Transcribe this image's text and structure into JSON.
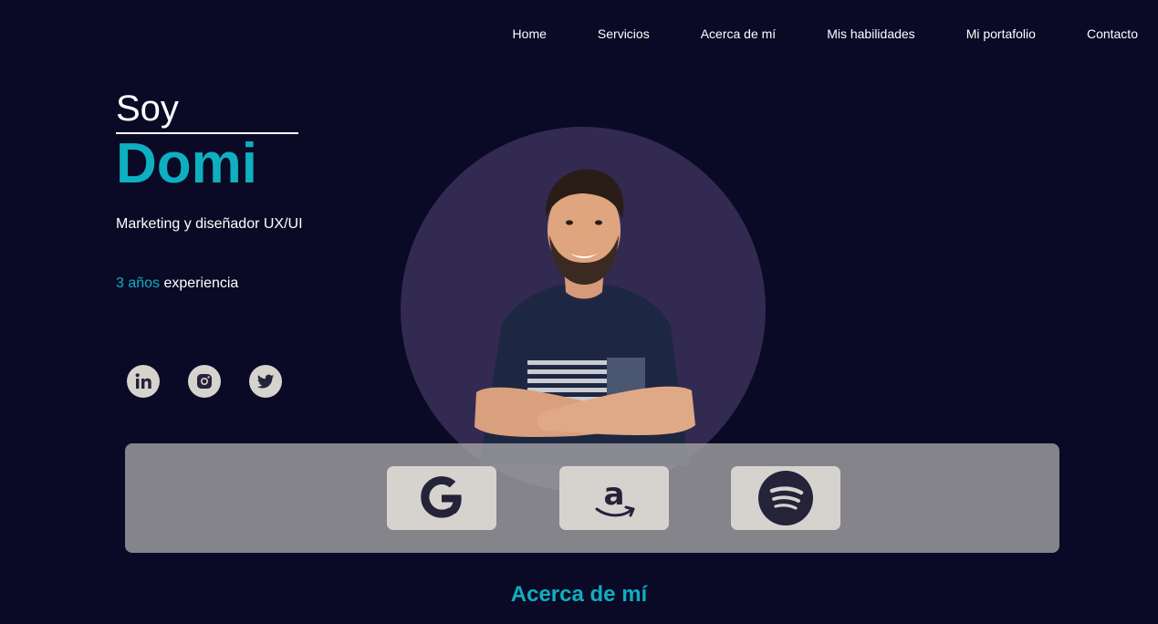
{
  "nav": {
    "items": [
      {
        "label": "Home"
      },
      {
        "label": "Servicios"
      },
      {
        "label": "Acerca de mí"
      },
      {
        "label": "Mis habilidades"
      },
      {
        "label": "Mi portafolio"
      },
      {
        "label": "Contacto"
      }
    ]
  },
  "hero": {
    "greeting": "Soy",
    "name": "Domi",
    "role": "Marketing y diseñador UX/UI",
    "experience_highlight": "3 años",
    "experience_rest": " experiencia"
  },
  "social": {
    "icons": [
      "linkedin-icon",
      "instagram-icon",
      "twitter-icon"
    ]
  },
  "brands": {
    "icons": [
      "google-icon",
      "amazon-icon",
      "spotify-icon"
    ]
  },
  "about": {
    "title": "Acerca de mí"
  },
  "colors": {
    "background": "#0a0a26",
    "accent": "#0eafc0",
    "circle": "#332a52",
    "icon_bg": "#d6d3cf",
    "icon_fg": "#25233a"
  }
}
